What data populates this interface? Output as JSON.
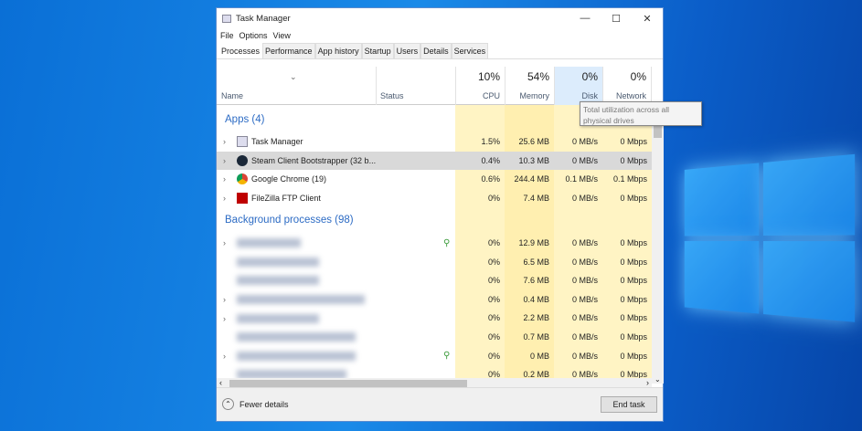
{
  "window": {
    "title": "Task Manager",
    "controls": [
      "—",
      "☐",
      "✕"
    ]
  },
  "menu": [
    "File",
    "Options",
    "View"
  ],
  "tabs": [
    "Processes",
    "Performance",
    "App history",
    "Startup",
    "Users",
    "Details",
    "Services"
  ],
  "header": {
    "name": "Name",
    "status": "Status",
    "cpu_pct": "10%",
    "cpu": "CPU",
    "mem_pct": "54%",
    "mem": "Memory",
    "disk_pct": "0%",
    "disk": "Disk",
    "net_pct": "0%",
    "net": "Network"
  },
  "tooltip": "Total utilization across all physical drives",
  "groups": {
    "apps": "Apps (4)",
    "background": "Background processes (98)"
  },
  "apps": [
    {
      "name": "Task Manager",
      "icon": "task-manager-icon",
      "cpu": "1.5%",
      "mem": "25.6 MB",
      "disk": "0 MB/s",
      "net": "0 Mbps"
    },
    {
      "name": "Steam Client Bootstrapper (32 b...",
      "icon": "steam-icon",
      "cpu": "0.4%",
      "mem": "10.3 MB",
      "disk": "0 MB/s",
      "net": "0 Mbps"
    },
    {
      "name": "Google Chrome (19)",
      "icon": "chrome-icon",
      "cpu": "0.6%",
      "mem": "244.4 MB",
      "disk": "0.1 MB/s",
      "net": "0.1 Mbps"
    },
    {
      "name": "FileZilla FTP Client",
      "icon": "filezilla-icon",
      "cpu": "0%",
      "mem": "7.4 MB",
      "disk": "0 MB/s",
      "net": "0 Mbps"
    }
  ],
  "background": [
    {
      "cpu": "0%",
      "mem": "12.9 MB",
      "disk": "0 MB/s",
      "net": "0 Mbps"
    },
    {
      "cpu": "0%",
      "mem": "6.5 MB",
      "disk": "0 MB/s",
      "net": "0 Mbps"
    },
    {
      "cpu": "0%",
      "mem": "7.6 MB",
      "disk": "0 MB/s",
      "net": "0 Mbps"
    },
    {
      "cpu": "0%",
      "mem": "0.4 MB",
      "disk": "0 MB/s",
      "net": "0 Mbps"
    },
    {
      "cpu": "0%",
      "mem": "2.2 MB",
      "disk": "0 MB/s",
      "net": "0 Mbps"
    },
    {
      "cpu": "0%",
      "mem": "0.7 MB",
      "disk": "0 MB/s",
      "net": "0 Mbps"
    },
    {
      "cpu": "0%",
      "mem": "0 MB",
      "disk": "0 MB/s",
      "net": "0 Mbps"
    },
    {
      "cpu": "0%",
      "mem": "0.2 MB",
      "disk": "0 MB/s",
      "net": "0 Mbps"
    }
  ],
  "footer": {
    "fewer": "Fewer details",
    "end_task": "End task"
  },
  "colors": {
    "heat_light": "#fff4c4",
    "heat_mid": "#ffeaa0",
    "group": "#2c6bc4"
  }
}
